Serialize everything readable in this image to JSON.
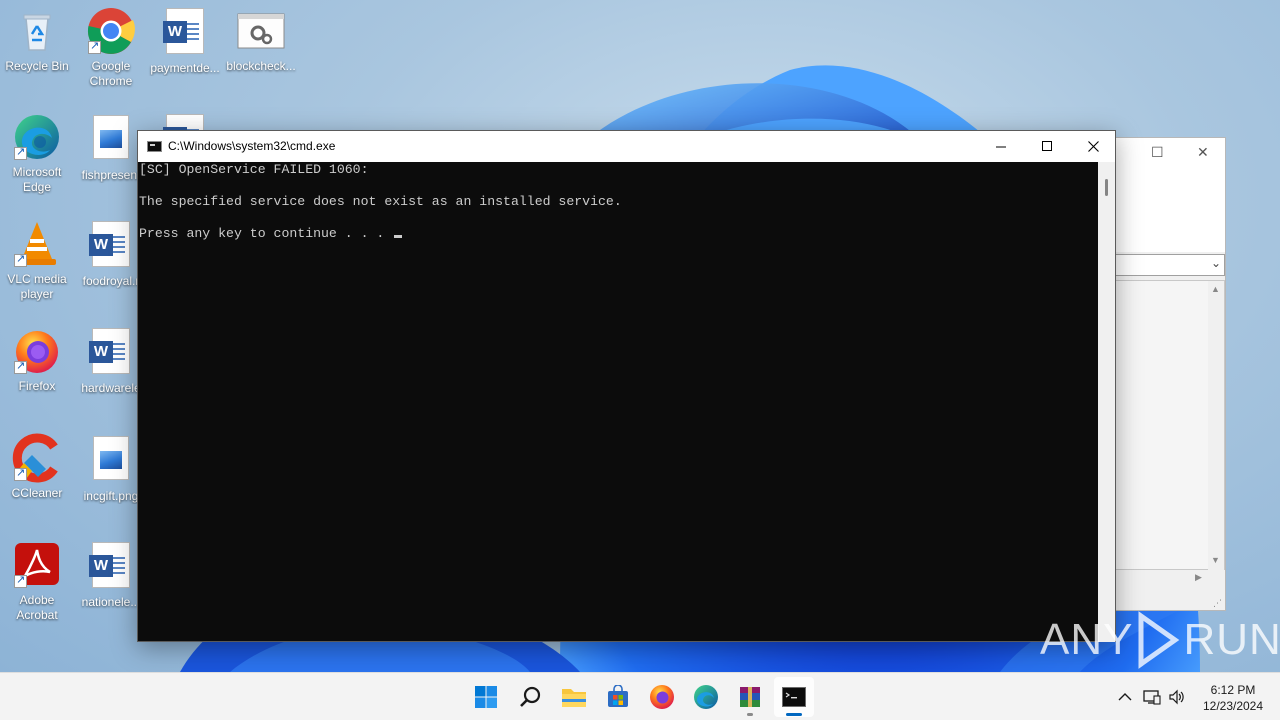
{
  "desktop": {
    "icons": [
      {
        "label": "Recycle Bin",
        "icon": "recycle-bin-icon"
      },
      {
        "label": "Google Chrome",
        "icon": "chrome-icon"
      },
      {
        "label": "paymentde...",
        "icon": "word-document-icon"
      },
      {
        "label": "blockcheck...",
        "icon": "settings-file-icon"
      },
      {
        "label": "Microsoft Edge",
        "icon": "edge-icon"
      },
      {
        "label": "fishpresent",
        "icon": "image-file-icon"
      },
      {
        "label": "VLC media player",
        "icon": "vlc-icon"
      },
      {
        "label": "foodroyal.r",
        "icon": "word-document-icon"
      },
      {
        "label": "Firefox",
        "icon": "firefox-icon"
      },
      {
        "label": "hardwarele",
        "icon": "word-document-icon"
      },
      {
        "label": "CCleaner",
        "icon": "ccleaner-icon"
      },
      {
        "label": "incgift.png",
        "icon": "image-file-icon"
      },
      {
        "label": "Adobe Acrobat",
        "icon": "acrobat-icon"
      },
      {
        "label": "nationele...",
        "icon": "word-document-icon"
      }
    ]
  },
  "cmd_window": {
    "title": "C:\\Windows\\system32\\cmd.exe",
    "lines": [
      "[SC] OpenService FAILED 1060:",
      "",
      "The specified service does not exist as an installed service.",
      "",
      "Press any key to continue . . . "
    ]
  },
  "watermark": {
    "left": "ANY",
    "right": "RUN"
  },
  "taskbar": {
    "apps": [
      "start-icon",
      "search-icon",
      "file-explorer-icon",
      "store-icon",
      "firefox-icon",
      "edge-icon",
      "winrar-icon",
      "cmd-icon"
    ],
    "clock": {
      "time": "6:12 PM",
      "date": "12/23/2024"
    }
  },
  "colors": {
    "console_bg": "#0c0c0c",
    "console_text": "#cccccc",
    "taskbar_bg": "#f3f3f3",
    "accent": "#0067c0"
  }
}
